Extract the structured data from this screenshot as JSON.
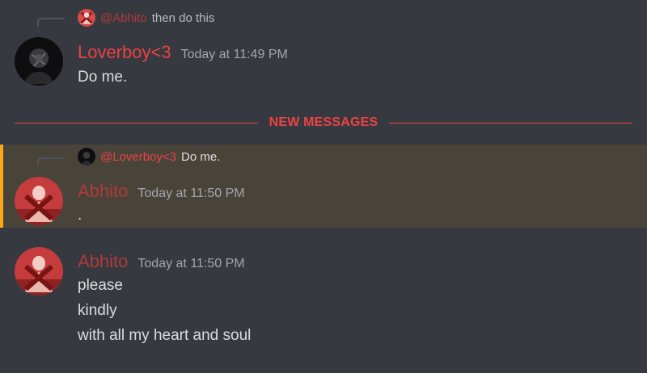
{
  "colors": {
    "background": "#36393f",
    "loverboy_name": "#ed4245",
    "abhito_name": "#b03a3a",
    "new_messages": "#ed4245",
    "mention_highlight": "#48443a",
    "mention_bar": "#faa81a"
  },
  "messages": {
    "m1": {
      "reply": {
        "user": "@Abhito",
        "text": "then do this"
      },
      "author": "Loverboy<3",
      "timestamp": "Today at 11:49 PM",
      "lines": [
        "Do me."
      ]
    },
    "divider_label": "NEW MESSAGES",
    "m2": {
      "reply": {
        "user": "@Loverboy<3",
        "text": "Do me."
      },
      "author": "Abhito",
      "timestamp": "Today at 11:50 PM",
      "lines": [
        "."
      ]
    },
    "m3": {
      "author": "Abhito",
      "timestamp": "Today at 11:50 PM",
      "lines": [
        "please",
        "kindly",
        "with all my heart and soul"
      ]
    }
  }
}
